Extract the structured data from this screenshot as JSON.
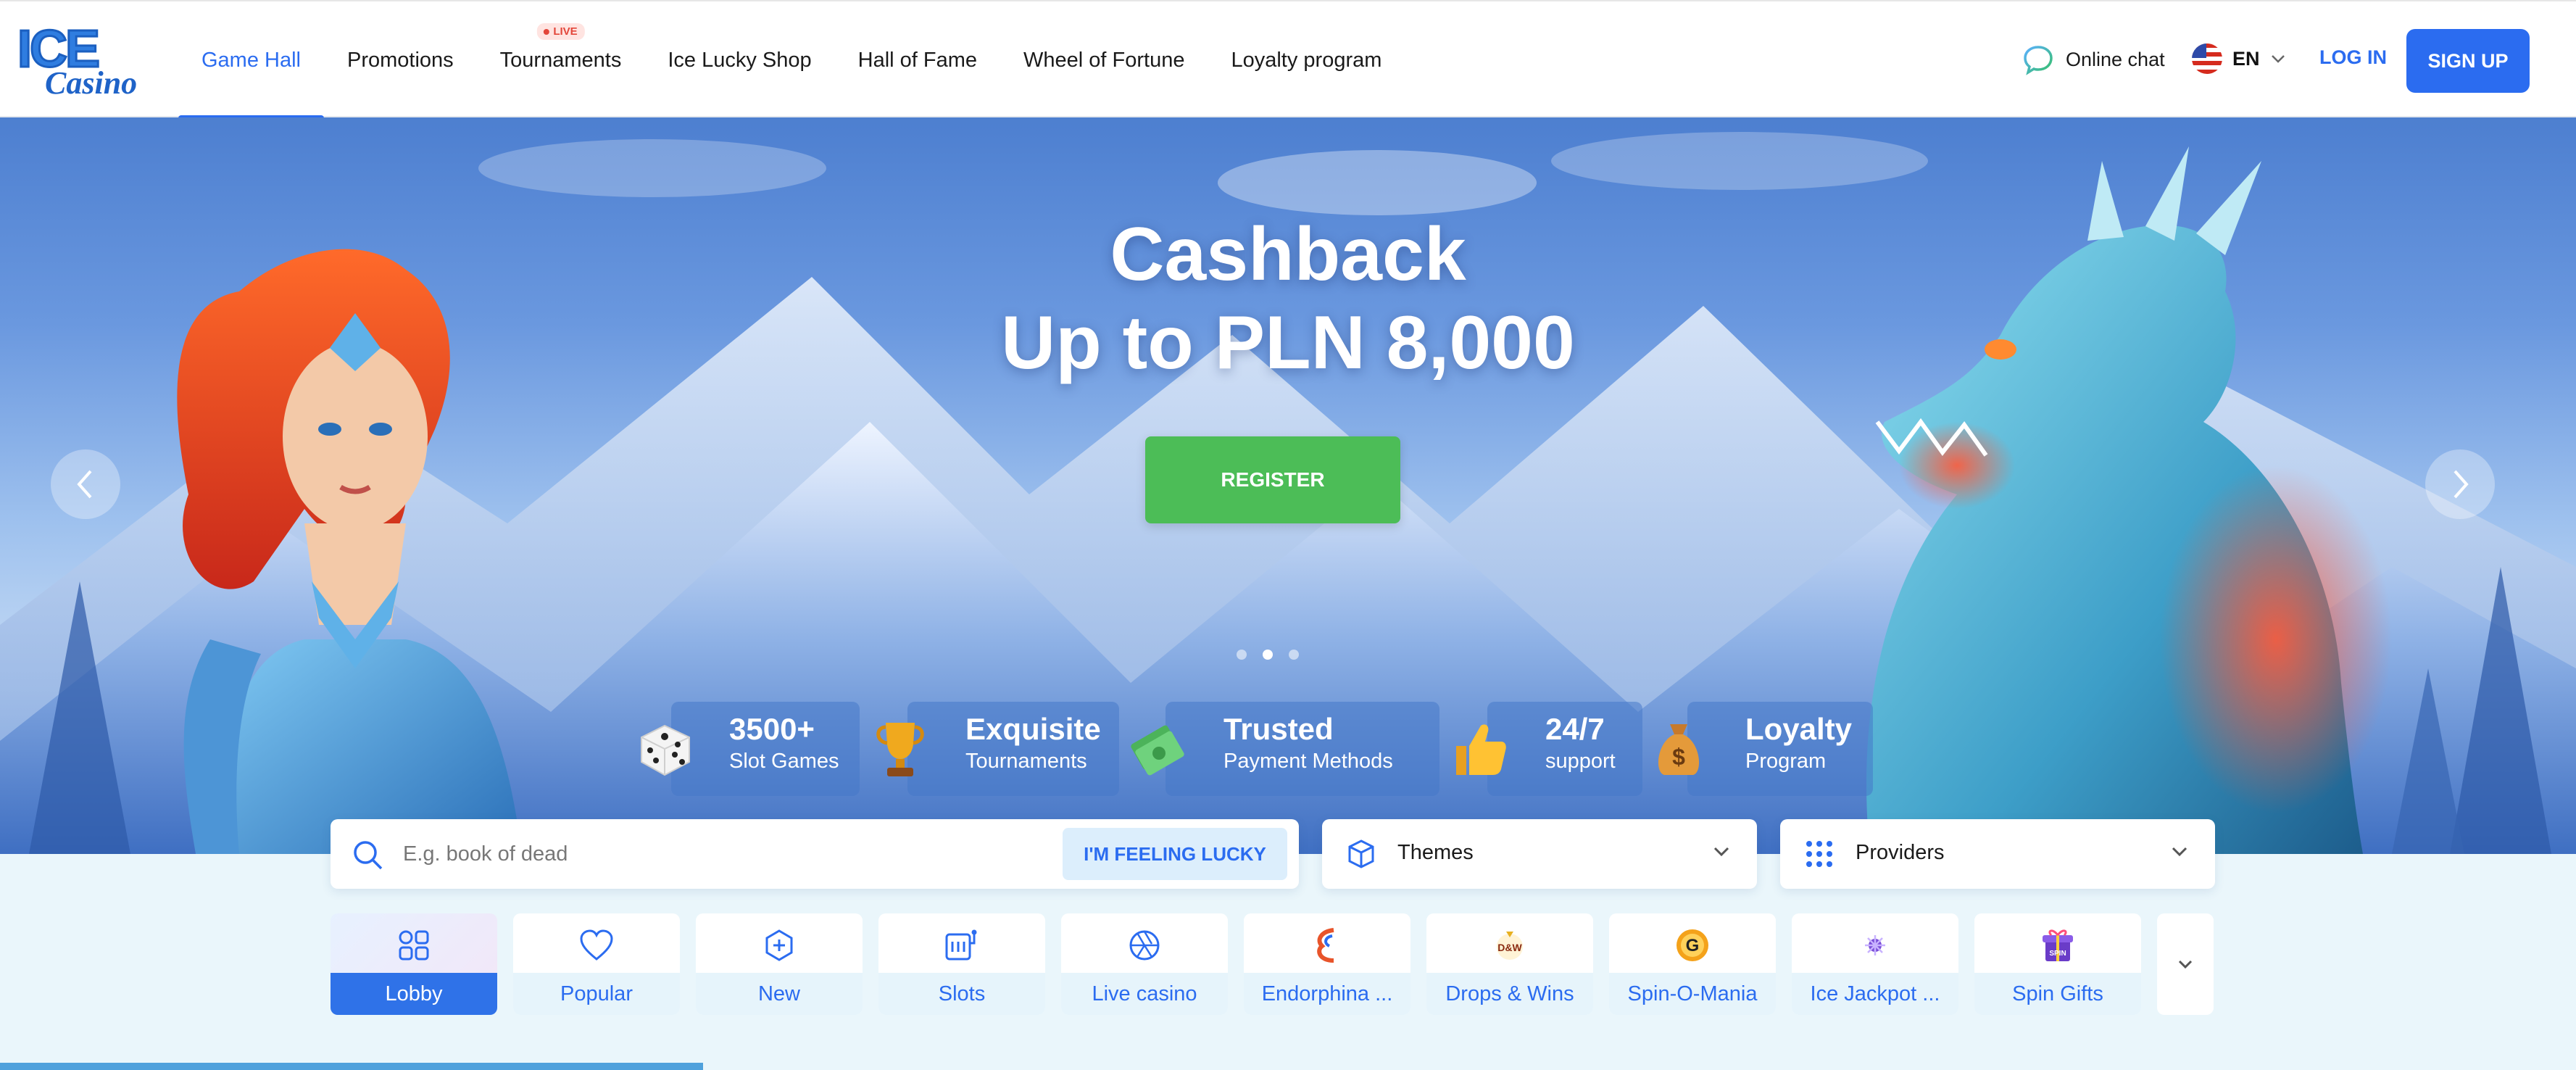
{
  "header": {
    "logo": {
      "line1": "ICE",
      "line2": "Casino"
    },
    "nav": [
      {
        "label": "Game Hall",
        "active": true
      },
      {
        "label": "Promotions"
      },
      {
        "label": "Tournaments",
        "badge": "LIVE"
      },
      {
        "label": "Ice Lucky Shop"
      },
      {
        "label": "Hall of Fame"
      },
      {
        "label": "Wheel of Fortune"
      },
      {
        "label": "Loyalty program"
      }
    ],
    "online_chat": "Online chat",
    "language": "EN",
    "login": "LOG IN",
    "signup": "SIGN UP"
  },
  "hero": {
    "title_line1": "Cashback",
    "title_line2": "Up to PLN 8,000",
    "register": "REGISTER",
    "slides_total": 3,
    "current_slide": 2
  },
  "features": [
    {
      "title": "3500+",
      "subtitle": "Slot Games",
      "icon": "dice-icon"
    },
    {
      "title": "Exquisite",
      "subtitle": "Tournaments",
      "icon": "trophy-icon"
    },
    {
      "title": "Trusted",
      "subtitle": "Payment Methods",
      "icon": "money-icon"
    },
    {
      "title": "24/7",
      "subtitle": "support",
      "icon": "thumbs-up-icon"
    },
    {
      "title": "Loyalty",
      "subtitle": "Program",
      "icon": "money-bag-icon"
    }
  ],
  "search": {
    "placeholder": "E.g. book of dead",
    "lucky_button": "I'M FEELING LUCKY"
  },
  "filters": {
    "themes": "Themes",
    "providers": "Providers"
  },
  "categories": [
    {
      "label": "Lobby",
      "icon": "grid-icon",
      "active": true
    },
    {
      "label": "Popular",
      "icon": "heart-icon"
    },
    {
      "label": "New",
      "icon": "plus-badge-icon"
    },
    {
      "label": "Slots",
      "icon": "slot-machine-icon"
    },
    {
      "label": "Live casino",
      "icon": "aperture-icon"
    },
    {
      "label": "Endorphina ...",
      "icon": "endorphina-logo-icon"
    },
    {
      "label": "Drops & Wins",
      "icon": "drops-wins-logo-icon"
    },
    {
      "label": "Spin-O-Mania",
      "icon": "spin-o-mania-logo-icon"
    },
    {
      "label": "Ice Jackpot ...",
      "icon": "ice-jackpot-logo-icon"
    },
    {
      "label": "Spin Gifts",
      "icon": "spin-gifts-logo-icon"
    }
  ],
  "colors": {
    "accent": "#2b6cf0",
    "register_green": "#4cbd57",
    "live_red": "#e3463a"
  }
}
